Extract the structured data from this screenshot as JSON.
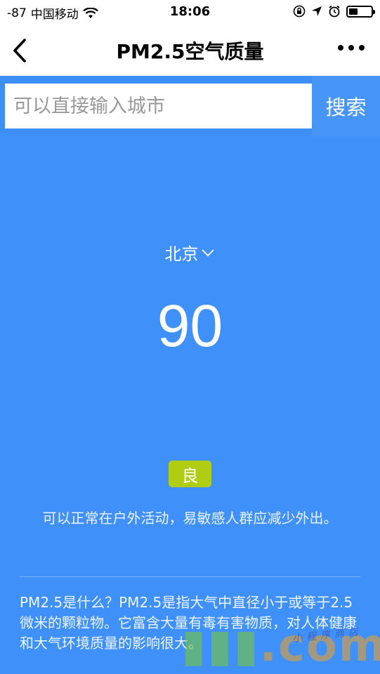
{
  "status_bar": {
    "signal": "-87",
    "carrier": "中国移动",
    "time": "18:06"
  },
  "nav": {
    "title": "PM2.5空气质量",
    "back_icon": "chevron-left-icon",
    "more_icon": "more-dots-icon"
  },
  "search": {
    "placeholder": "可以直接输入城市",
    "value": "",
    "button_label": "搜索"
  },
  "air": {
    "city": "北京",
    "pm25": "90",
    "level": "良",
    "level_color": "#b0cc13",
    "advice": "可以正常在户外活动，易敏感人群应减少外出。"
  },
  "info": {
    "description": "PM2.5是什么？PM2.5是指大气中直径小于或等于2.5微米的颗粒物。它富含大量有毒有害物质，对人体健康和大气环境质量的影响很大。"
  },
  "watermark": {
    "main": ".com",
    "small": "小程序商店"
  },
  "colors": {
    "primary_blue": "#3f90f8",
    "search_button": "#4895f8"
  }
}
